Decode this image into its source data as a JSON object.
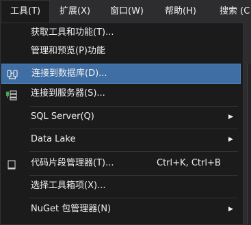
{
  "menubar": {
    "items": [
      {
        "label": "工具(T)"
      },
      {
        "label": "扩展(X)"
      },
      {
        "label": "窗口(W)"
      },
      {
        "label": "帮助(H)"
      },
      {
        "label": "搜索 (C"
      }
    ]
  },
  "menu": {
    "items": [
      {
        "label": "获取工具和功能(T)..."
      },
      {
        "label": "管理和预览(P)功能"
      },
      {
        "label": "连接到数据库(D)...",
        "icon": "database-connect-icon"
      },
      {
        "label": "连接到服务器(S)...",
        "icon": "server-connect-icon"
      },
      {
        "label": "SQL Server(Q)"
      },
      {
        "label": "Data Lake"
      },
      {
        "label": "代码片段管理器(T)...",
        "shortcut": "Ctrl+K, Ctrl+B",
        "icon": "code-snippet-icon"
      },
      {
        "label": "选择工具箱项(X)..."
      },
      {
        "label": "NuGet 包管理器(N)"
      }
    ]
  },
  "colors": {
    "menu_bg": "#1b1b1c",
    "menubar_bg": "#2d2d30",
    "highlight_bg": "#3e6ea4",
    "text": "#f1f1f1"
  }
}
